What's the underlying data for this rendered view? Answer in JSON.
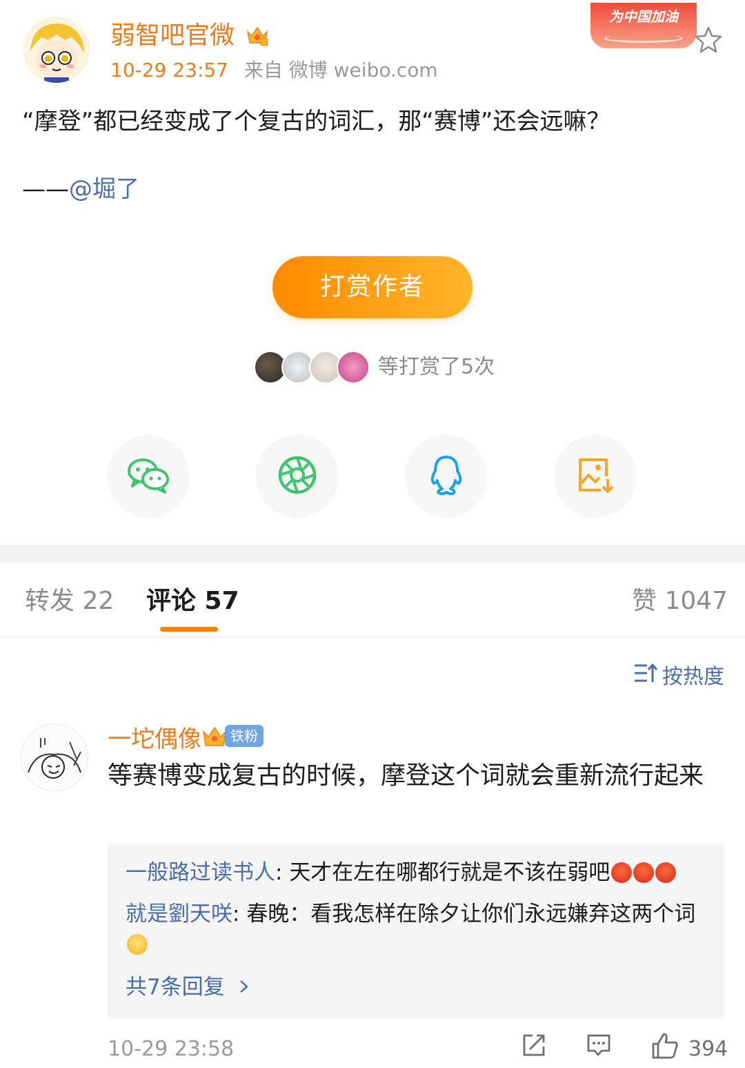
{
  "post": {
    "author": "弱智吧官微",
    "date": "10-29 23:57",
    "source": "来自 微博 weibo.com",
    "promo_badge": "为中国加油",
    "text": "“摩登”都已经变成了个复古的词汇，那“赛博”还会远嘛？",
    "signature_prefix": "——",
    "signature_mention": "@堀了",
    "reward_button": "打赏作者",
    "reward_summary": "等打赏了5次"
  },
  "share": {
    "items": [
      {
        "icon": "wechat-icon",
        "color": "#3fc46f"
      },
      {
        "icon": "moments-icon",
        "color": "#3fc46f"
      },
      {
        "icon": "qq-icon",
        "color": "#1aa3ec"
      },
      {
        "icon": "save-image-icon",
        "color": "#f5a623"
      }
    ]
  },
  "tabs": {
    "repost": "转发 22",
    "comments": "评论 57",
    "likes": "赞 1047"
  },
  "sort": {
    "label": "按热度"
  },
  "comment": {
    "author": "一坨偶像",
    "fan_badge": "铁粉",
    "text": "等赛博变成复古的时候，摩登这个词就会重新流行起来",
    "replies": [
      {
        "name": "一般路过读书人",
        "separator": ": ",
        "text": "天才在左在哪都行就是不该在弱吧"
      },
      {
        "name": "就是劉天咲",
        "separator": ": ",
        "text": "春晚：看我怎样在除夕让你们永远嫌弃这两个词"
      }
    ],
    "more_replies": "共7条回复",
    "time": "10-29 23:58",
    "like_count": "394"
  },
  "colors": {
    "accent_orange": "#f07a1a",
    "link_blue": "#4a6ea8",
    "reward_gradient_start": "#ff8a00",
    "reward_gradient_end": "#ffb52a"
  }
}
